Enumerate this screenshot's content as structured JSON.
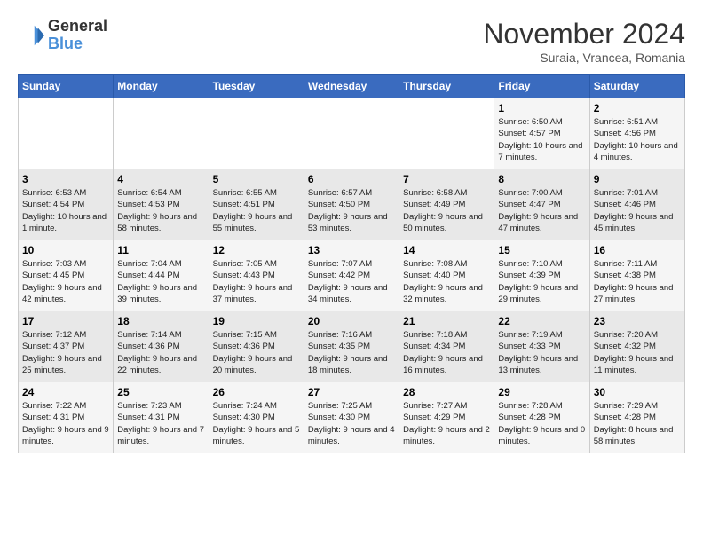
{
  "logo": {
    "text_general": "General",
    "text_blue": "Blue"
  },
  "header": {
    "month": "November 2024",
    "location": "Suraia, Vrancea, Romania"
  },
  "days_of_week": [
    "Sunday",
    "Monday",
    "Tuesday",
    "Wednesday",
    "Thursday",
    "Friday",
    "Saturday"
  ],
  "weeks": [
    [
      {
        "day": "",
        "info": ""
      },
      {
        "day": "",
        "info": ""
      },
      {
        "day": "",
        "info": ""
      },
      {
        "day": "",
        "info": ""
      },
      {
        "day": "",
        "info": ""
      },
      {
        "day": "1",
        "info": "Sunrise: 6:50 AM\nSunset: 4:57 PM\nDaylight: 10 hours and 7 minutes."
      },
      {
        "day": "2",
        "info": "Sunrise: 6:51 AM\nSunset: 4:56 PM\nDaylight: 10 hours and 4 minutes."
      }
    ],
    [
      {
        "day": "3",
        "info": "Sunrise: 6:53 AM\nSunset: 4:54 PM\nDaylight: 10 hours and 1 minute."
      },
      {
        "day": "4",
        "info": "Sunrise: 6:54 AM\nSunset: 4:53 PM\nDaylight: 9 hours and 58 minutes."
      },
      {
        "day": "5",
        "info": "Sunrise: 6:55 AM\nSunset: 4:51 PM\nDaylight: 9 hours and 55 minutes."
      },
      {
        "day": "6",
        "info": "Sunrise: 6:57 AM\nSunset: 4:50 PM\nDaylight: 9 hours and 53 minutes."
      },
      {
        "day": "7",
        "info": "Sunrise: 6:58 AM\nSunset: 4:49 PM\nDaylight: 9 hours and 50 minutes."
      },
      {
        "day": "8",
        "info": "Sunrise: 7:00 AM\nSunset: 4:47 PM\nDaylight: 9 hours and 47 minutes."
      },
      {
        "day": "9",
        "info": "Sunrise: 7:01 AM\nSunset: 4:46 PM\nDaylight: 9 hours and 45 minutes."
      }
    ],
    [
      {
        "day": "10",
        "info": "Sunrise: 7:03 AM\nSunset: 4:45 PM\nDaylight: 9 hours and 42 minutes."
      },
      {
        "day": "11",
        "info": "Sunrise: 7:04 AM\nSunset: 4:44 PM\nDaylight: 9 hours and 39 minutes."
      },
      {
        "day": "12",
        "info": "Sunrise: 7:05 AM\nSunset: 4:43 PM\nDaylight: 9 hours and 37 minutes."
      },
      {
        "day": "13",
        "info": "Sunrise: 7:07 AM\nSunset: 4:42 PM\nDaylight: 9 hours and 34 minutes."
      },
      {
        "day": "14",
        "info": "Sunrise: 7:08 AM\nSunset: 4:40 PM\nDaylight: 9 hours and 32 minutes."
      },
      {
        "day": "15",
        "info": "Sunrise: 7:10 AM\nSunset: 4:39 PM\nDaylight: 9 hours and 29 minutes."
      },
      {
        "day": "16",
        "info": "Sunrise: 7:11 AM\nSunset: 4:38 PM\nDaylight: 9 hours and 27 minutes."
      }
    ],
    [
      {
        "day": "17",
        "info": "Sunrise: 7:12 AM\nSunset: 4:37 PM\nDaylight: 9 hours and 25 minutes."
      },
      {
        "day": "18",
        "info": "Sunrise: 7:14 AM\nSunset: 4:36 PM\nDaylight: 9 hours and 22 minutes."
      },
      {
        "day": "19",
        "info": "Sunrise: 7:15 AM\nSunset: 4:36 PM\nDaylight: 9 hours and 20 minutes."
      },
      {
        "day": "20",
        "info": "Sunrise: 7:16 AM\nSunset: 4:35 PM\nDaylight: 9 hours and 18 minutes."
      },
      {
        "day": "21",
        "info": "Sunrise: 7:18 AM\nSunset: 4:34 PM\nDaylight: 9 hours and 16 minutes."
      },
      {
        "day": "22",
        "info": "Sunrise: 7:19 AM\nSunset: 4:33 PM\nDaylight: 9 hours and 13 minutes."
      },
      {
        "day": "23",
        "info": "Sunrise: 7:20 AM\nSunset: 4:32 PM\nDaylight: 9 hours and 11 minutes."
      }
    ],
    [
      {
        "day": "24",
        "info": "Sunrise: 7:22 AM\nSunset: 4:31 PM\nDaylight: 9 hours and 9 minutes."
      },
      {
        "day": "25",
        "info": "Sunrise: 7:23 AM\nSunset: 4:31 PM\nDaylight: 9 hours and 7 minutes."
      },
      {
        "day": "26",
        "info": "Sunrise: 7:24 AM\nSunset: 4:30 PM\nDaylight: 9 hours and 5 minutes."
      },
      {
        "day": "27",
        "info": "Sunrise: 7:25 AM\nSunset: 4:30 PM\nDaylight: 9 hours and 4 minutes."
      },
      {
        "day": "28",
        "info": "Sunrise: 7:27 AM\nSunset: 4:29 PM\nDaylight: 9 hours and 2 minutes."
      },
      {
        "day": "29",
        "info": "Sunrise: 7:28 AM\nSunset: 4:28 PM\nDaylight: 9 hours and 0 minutes."
      },
      {
        "day": "30",
        "info": "Sunrise: 7:29 AM\nSunset: 4:28 PM\nDaylight: 8 hours and 58 minutes."
      }
    ]
  ]
}
